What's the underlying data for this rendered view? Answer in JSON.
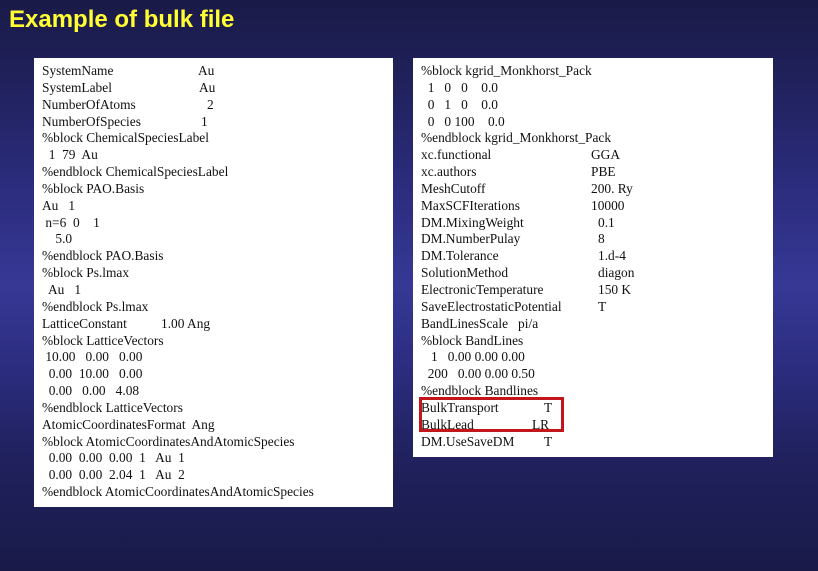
{
  "title": "Example of bulk file",
  "colors": {
    "title": "#ffff33",
    "background_top": "#1a1a48",
    "background_mid": "#363895",
    "panel": "#ffffff",
    "text": "#111111",
    "highlight_border": "#c0161c"
  },
  "left_panel": {
    "lines": [
      {
        "key": "SystemName",
        "value": "Au"
      },
      {
        "key": "SystemLabel",
        "value": "Au"
      },
      {
        "key": "NumberOfAtoms",
        "value": "2"
      },
      {
        "key": "NumberOfSpecies",
        "value": "1"
      },
      {
        "key": "%block ChemicalSpeciesLabel",
        "value": ""
      },
      {
        "key": "  1  79  Au",
        "value": ""
      },
      {
        "key": "%endblock ChemicalSpeciesLabel",
        "value": ""
      },
      {
        "key": "%block PAO.Basis",
        "value": ""
      },
      {
        "key": "Au   1",
        "value": ""
      },
      {
        "key": " n=6  0    1",
        "value": ""
      },
      {
        "key": "    5.0",
        "value": ""
      },
      {
        "key": "%endblock PAO.Basis",
        "value": ""
      },
      {
        "key": "%block Ps.lmax",
        "value": ""
      },
      {
        "key": "  Au   1",
        "value": ""
      },
      {
        "key": "%endblock Ps.lmax",
        "value": ""
      },
      {
        "key": "LatticeConstant",
        "value": "1.00 Ang"
      },
      {
        "key": "%block LatticeVectors",
        "value": ""
      },
      {
        "key": " 10.00   0.00   0.00",
        "value": ""
      },
      {
        "key": "  0.00  10.00   0.00",
        "value": ""
      },
      {
        "key": "  0.00   0.00   4.08",
        "value": ""
      },
      {
        "key": "%endblock LatticeVectors",
        "value": ""
      },
      {
        "key": "AtomicCoordinatesFormat  Ang",
        "value": ""
      },
      {
        "key": "%block AtomicCoordinatesAndAtomicSpecies",
        "value": ""
      },
      {
        "key": "  0.00  0.00  0.00  1   Au  1",
        "value": ""
      },
      {
        "key": "  0.00  0.00  2.04  1   Au  2",
        "value": ""
      },
      {
        "key": "%endblock AtomicCoordinatesAndAtomicSpecies",
        "value": ""
      }
    ]
  },
  "right_panel": {
    "lines": [
      {
        "key": "%block kgrid_Monkhorst_Pack",
        "value": ""
      },
      {
        "key": "  1   0   0    0.0",
        "value": ""
      },
      {
        "key": "  0   1   0    0.0",
        "value": ""
      },
      {
        "key": "  0   0 100    0.0",
        "value": ""
      },
      {
        "key": "%endblock kgrid_Monkhorst_Pack",
        "value": ""
      },
      {
        "key": "xc.functional",
        "value": "GGA"
      },
      {
        "key": "xc.authors",
        "value": "PBE"
      },
      {
        "key": "MeshCutoff",
        "value": "200. Ry"
      },
      {
        "key": "MaxSCFIterations",
        "value": "10000"
      },
      {
        "key": "DM.MixingWeight",
        "value": "0.1"
      },
      {
        "key": "DM.NumberPulay",
        "value": "8"
      },
      {
        "key": "DM.Tolerance",
        "value": "1.d-4"
      },
      {
        "key": "SolutionMethod",
        "value": "diagon"
      },
      {
        "key": "ElectronicTemperature",
        "value": "150 K"
      },
      {
        "key": "SaveElectrostaticPotential",
        "value": "T"
      },
      {
        "key": "BandLinesScale   pi/a",
        "value": ""
      },
      {
        "key": "%block BandLines",
        "value": ""
      },
      {
        "key": "   1   0.00 0.00 0.00",
        "value": ""
      },
      {
        "key": "  200   0.00 0.00 0.50",
        "value": ""
      },
      {
        "key": "%endblock Bandlines",
        "value": ""
      },
      {
        "key": "BulkTransport",
        "value": "T"
      },
      {
        "key": "BulkLead",
        "value": "LR"
      },
      {
        "key": "DM.UseSaveDM",
        "value": "T"
      }
    ],
    "highlighted_keys": [
      "BulkTransport",
      "BulkLead"
    ]
  }
}
